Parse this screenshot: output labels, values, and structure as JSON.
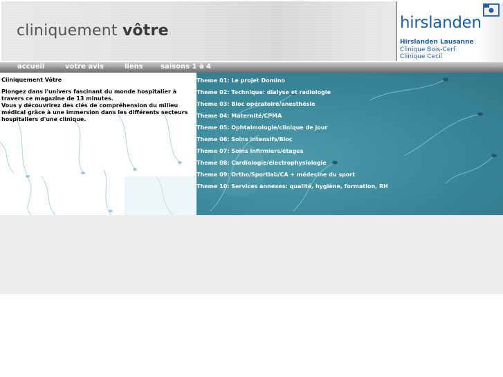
{
  "header": {
    "title_light": "cliniquement ",
    "title_bold": "vôtre",
    "brand": {
      "logo_text": "hirslanden",
      "line1": "Hirslanden Lausanne",
      "line2": "Clinique Bois-Cerf",
      "line3": "Clinique Cecil",
      "color": "#1d5f9e"
    }
  },
  "nav": {
    "items": [
      {
        "label": "accueil"
      },
      {
        "label": "votre avis"
      },
      {
        "label": "liens"
      },
      {
        "label": "saisons 1 à 4"
      }
    ]
  },
  "intro": {
    "title": "Cliniquement Vôtre",
    "paragraph1": "Plongez dans l'univers fascinant du monde hospitalier à travers ce magazine de 13 minutes.",
    "paragraph2": "Vous y découvrirez des clés de compréhension du milieu médical grâce à une immersion dans les différents secteurs hospitaliers d'une clinique."
  },
  "themes": [
    {
      "label": "Theme 01: Le projet Domino"
    },
    {
      "label": "Theme 02: Technique: dialyse et radiologie"
    },
    {
      "label": "Theme 03: Bloc opératoire/anesthésie"
    },
    {
      "label": "Theme 04: Maternité/CPMA"
    },
    {
      "label": "Theme 05: Ophtalmologie/clinique de jour"
    },
    {
      "label": "Theme 06: Soins intensifs/Bloc"
    },
    {
      "label": "Theme 07: Soins infirmiers/étages"
    },
    {
      "label": "Theme 08: Cardiologie/électrophysiologie"
    },
    {
      "label": "Theme 09: Ortho/Sportlab/CA + médecine du sport"
    },
    {
      "label": "Theme 10: Services annexes: qualité, hygiène, formation, RH"
    }
  ],
  "colors": {
    "accent_teal": "#3c8a9c",
    "nav_grey": "#8c8c8c",
    "footer_grey": "#ededed"
  }
}
